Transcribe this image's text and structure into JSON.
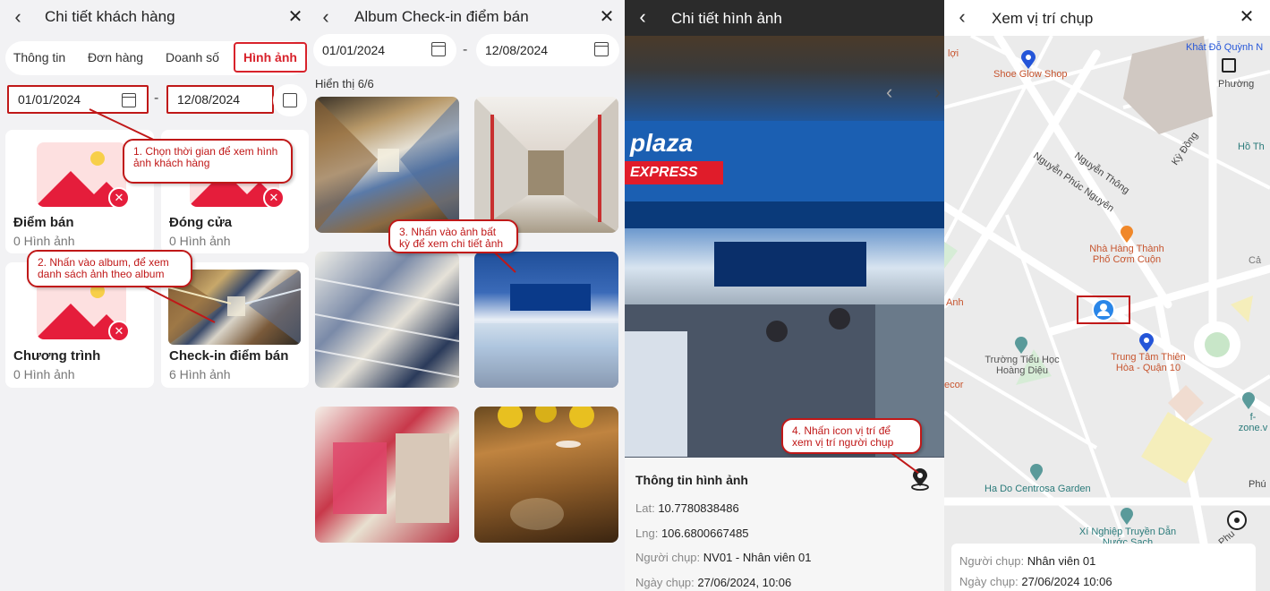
{
  "panel1": {
    "title": "Chi tiết khách hàng",
    "tabs": [
      "Thông tin",
      "Đơn hàng",
      "Doanh số",
      "Hình ảnh"
    ],
    "date_from": "01/01/2024",
    "date_to": "12/08/2024",
    "date_sep": "-",
    "albums": [
      {
        "title": "Điểm bán",
        "count": "0 Hình ảnh"
      },
      {
        "title": "Đóng cửa",
        "count": "0 Hình ảnh"
      },
      {
        "title": "Chương trình",
        "count": "0 Hình ảnh"
      },
      {
        "title": "Check-in điểm bán",
        "count": "6 Hình ảnh"
      }
    ],
    "callout1": "1. Chọn thời gian để xem hình ảnh khách hàng",
    "callout2": "2. Nhấn vào album, để xem danh sách ảnh theo album"
  },
  "panel2": {
    "title": "Album Check-in điểm bán",
    "date_from": "01/01/2024",
    "date_to": "12/08/2024",
    "date_sep": "-",
    "showing": "Hiển thị 6/6",
    "callout3": "3. Nhấn vào ảnh bất kỳ để xem chi tiết ảnh"
  },
  "panel3": {
    "title": "Chi tiết hình ảnh",
    "store_sign": "plaza",
    "store_sub": "EXPRESS",
    "info_title": "Thông tin hình ảnh",
    "lat_label": "Lat:",
    "lat": "10.7780838486",
    "lng_label": "Lng:",
    "lng": "106.6800667485",
    "taker_label": "Người chụp:",
    "taker": "NV01 - Nhân viên 01",
    "date_label": "Ngày chụp:",
    "date": "27/06/2024, 10:06",
    "callout4": "4. Nhấn icon vị trí để xem vị trí người chụp"
  },
  "panel4": {
    "title": "Xem vị trí chụp",
    "places": {
      "shoe": "Shoe Glow Shop",
      "khat": "Khát Đỗ Quỳnh N",
      "phuong": "Phường",
      "nguyen_thong": "Nguyễn Thông",
      "nguyen_phuc": "Nguyễn Phúc Nguyên",
      "ky_dong": "Kỳ Đồng",
      "hoth": "Hồ Th",
      "restaurant": "Nhà Hàng Thành Phố Cơm Cuộn",
      "cal": "Cả",
      "anh": "Anh",
      "school": "Trường Tiểu Học Hoàng Diệu",
      "trungtam": "Trung Tâm Thiên Hòa - Quận 10",
      "decor": "ecor",
      "fzone": "f-zone.v",
      "hado": "Ha Do Centrosa Garden",
      "xinghiep": "Xí Nghiệp Truyền Dẫn Nước Sạch",
      "loi": "lợi",
      "phu": "Phú",
      "phu2": "Phu"
    },
    "taker_label": "Người chụp:",
    "taker": "Nhân viên 01",
    "date_label": "Ngày chụp:",
    "date": "27/06/2024 10:06"
  }
}
